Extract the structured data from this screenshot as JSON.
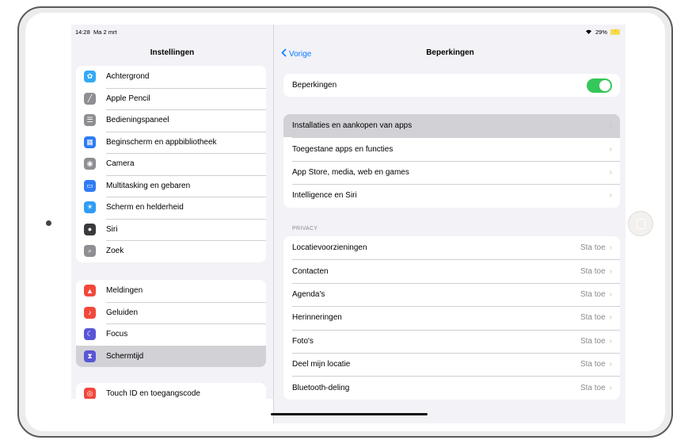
{
  "status": {
    "time": "14:28",
    "date": "Ma 2 mrt",
    "battery": "29%"
  },
  "sidebar": {
    "title": "Instellingen",
    "groups": [
      {
        "items": [
          {
            "label": "Achtergrond",
            "icon": "wallpaper-icon",
            "color": "#33aaf5"
          },
          {
            "label": "Apple Pencil",
            "icon": "pencil-icon",
            "color": "#8e8e93"
          },
          {
            "label": "Bedieningspaneel",
            "icon": "control-center-icon",
            "color": "#8e8e93"
          },
          {
            "label": "Beginscherm en appbibliotheek",
            "icon": "home-screen-icon",
            "color": "#2f7cf6"
          },
          {
            "label": "Camera",
            "icon": "camera-icon",
            "color": "#8e8e93"
          },
          {
            "label": "Multitasking en gebaren",
            "icon": "multitasking-icon",
            "color": "#2f7cf6"
          },
          {
            "label": "Scherm en helderheid",
            "icon": "brightness-icon",
            "color": "#2f9cf6"
          },
          {
            "label": "Siri",
            "icon": "siri-icon",
            "color": "#3a3a3c"
          },
          {
            "label": "Zoek",
            "icon": "search-icon",
            "color": "#8e8e93"
          }
        ]
      },
      {
        "items": [
          {
            "label": "Meldingen",
            "icon": "notifications-icon",
            "color": "#f2483c"
          },
          {
            "label": "Geluiden",
            "icon": "sounds-icon",
            "color": "#f2483c"
          },
          {
            "label": "Focus",
            "icon": "focus-moon-icon",
            "color": "#5856d6"
          },
          {
            "label": "Schermtijd",
            "icon": "hourglass-icon",
            "color": "#5856d6",
            "active": true
          }
        ]
      },
      {
        "items": [
          {
            "label": "Touch ID en toegangscode",
            "icon": "fingerprint-icon",
            "color": "#f2483c"
          }
        ]
      }
    ]
  },
  "detail": {
    "back_label": "Vorige",
    "title": "Beperkingen",
    "toggle_row": {
      "label": "Beperkingen",
      "state": "on"
    },
    "group2": [
      {
        "label": "Installaties en aankopen van apps",
        "active": true
      },
      {
        "label": "Toegestane apps en functies"
      },
      {
        "label": "App Store, media, web en games"
      },
      {
        "label": "Intelligence en Siri"
      }
    ],
    "privacy_header": "PRIVACY",
    "privacy": [
      {
        "label": "Locatievoorzieningen",
        "value": "Sta toe"
      },
      {
        "label": "Contacten",
        "value": "Sta toe"
      },
      {
        "label": "Agenda's",
        "value": "Sta toe"
      },
      {
        "label": "Herinneringen",
        "value": "Sta toe"
      },
      {
        "label": "Foto's",
        "value": "Sta toe"
      },
      {
        "label": "Deel mijn locatie",
        "value": "Sta toe"
      },
      {
        "label": "Bluetooth-deling",
        "value": "Sta toe"
      }
    ]
  }
}
